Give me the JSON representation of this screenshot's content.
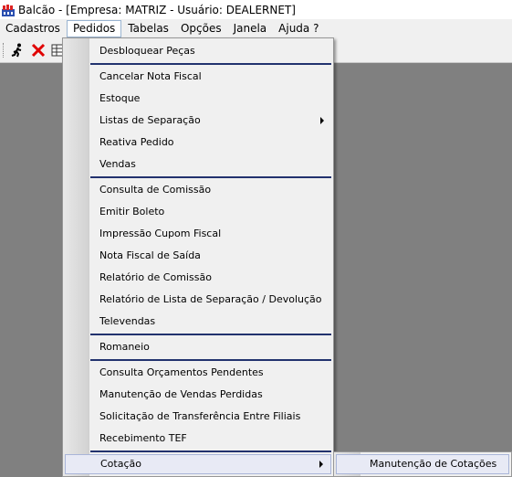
{
  "window": {
    "title": "Balcão - [Empresa: MATRIZ - Usuário: DEALERNET]"
  },
  "menubar": {
    "items": [
      {
        "label": "Cadastros"
      },
      {
        "label": "Pedidos"
      },
      {
        "label": "Tabelas"
      },
      {
        "label": "Opções"
      },
      {
        "label": "Janela"
      },
      {
        "label": "Ajuda ?"
      }
    ]
  },
  "toolbar": {
    "buttons": [
      {
        "icon": "running-man-icon"
      },
      {
        "icon": "close-red-x-icon"
      },
      {
        "icon": "grid-icon"
      }
    ]
  },
  "pedidos_menu": {
    "items": [
      {
        "label": "Desbloquear Peças"
      },
      {
        "label": "Cancelar Nota Fiscal"
      },
      {
        "label": "Estoque"
      },
      {
        "label": "Listas de Separação"
      },
      {
        "label": "Reativa Pedido"
      },
      {
        "label": "Vendas"
      },
      {
        "label": "Consulta de Comissão"
      },
      {
        "label": "Emitir Boleto"
      },
      {
        "label": "Impressão Cupom Fiscal"
      },
      {
        "label": "Nota Fiscal de Saída"
      },
      {
        "label": "Relatório de Comissão"
      },
      {
        "label": "Relatório de Lista de Separação / Devolução"
      },
      {
        "label": "Televendas"
      },
      {
        "label": "Romaneio"
      },
      {
        "label": "Consulta Orçamentos Pendentes"
      },
      {
        "label": "Manutenção de Vendas Perdidas"
      },
      {
        "label": "Solicitação de Transferência Entre Filiais"
      },
      {
        "label": "Recebimento TEF"
      },
      {
        "label": "Cotação"
      }
    ]
  },
  "cotacao_submenu": {
    "items": [
      {
        "label": "Manutenção de Cotações"
      }
    ]
  },
  "colors": {
    "desktop": "#808080",
    "menu_background": "#f0f0f0",
    "separator": "#22326e",
    "highlight": "#e8eaf5",
    "icon_red": "#e00000"
  }
}
